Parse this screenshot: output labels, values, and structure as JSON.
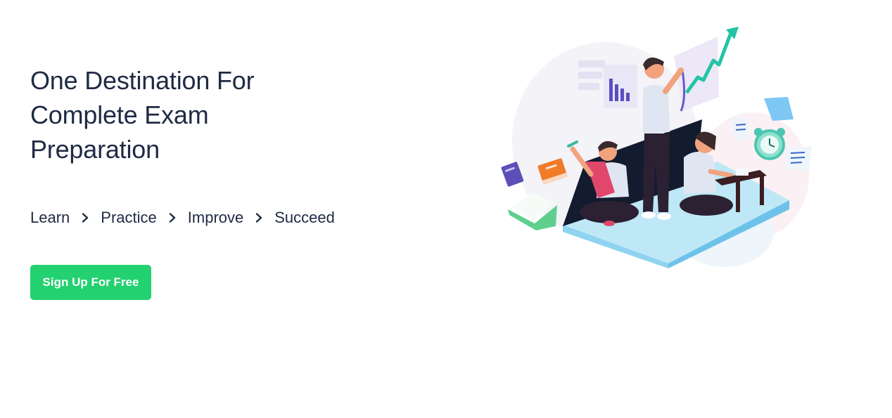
{
  "hero": {
    "title": "One Destination For Complete Exam Preparation",
    "steps": [
      "Learn",
      "Practice",
      "Improve",
      "Succeed"
    ],
    "cta_label": "Sign Up For Free"
  },
  "colors": {
    "heading": "#1f2a44",
    "cta_background": "#23d170",
    "cta_text": "#ffffff"
  },
  "illustration": {
    "icon": "students-studying-illustration"
  }
}
